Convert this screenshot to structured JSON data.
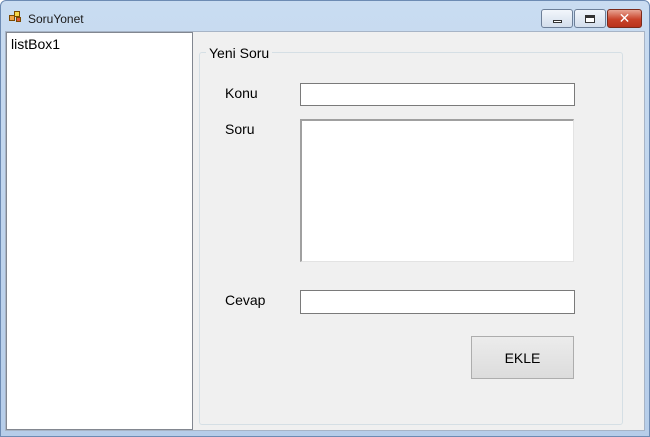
{
  "window": {
    "title": "SoruYonet"
  },
  "listbox": {
    "items": [
      "listBox1"
    ]
  },
  "group": {
    "title": "Yeni Soru"
  },
  "form": {
    "konu_label": "Konu",
    "konu_value": "",
    "soru_label": "Soru",
    "soru_value": "",
    "cevap_label": "Cevap",
    "cevap_value": ""
  },
  "buttons": {
    "add_label": "EKLE",
    "close_glyph": "✕"
  },
  "icons": {
    "app": "app-icon",
    "minimize": "minimize-icon",
    "maximize": "maximize-icon",
    "close": "close-icon"
  },
  "colors": {
    "titlebar": "#c9dcf1",
    "close_button": "#c9432a",
    "client_bg": "#f0f0f0"
  }
}
